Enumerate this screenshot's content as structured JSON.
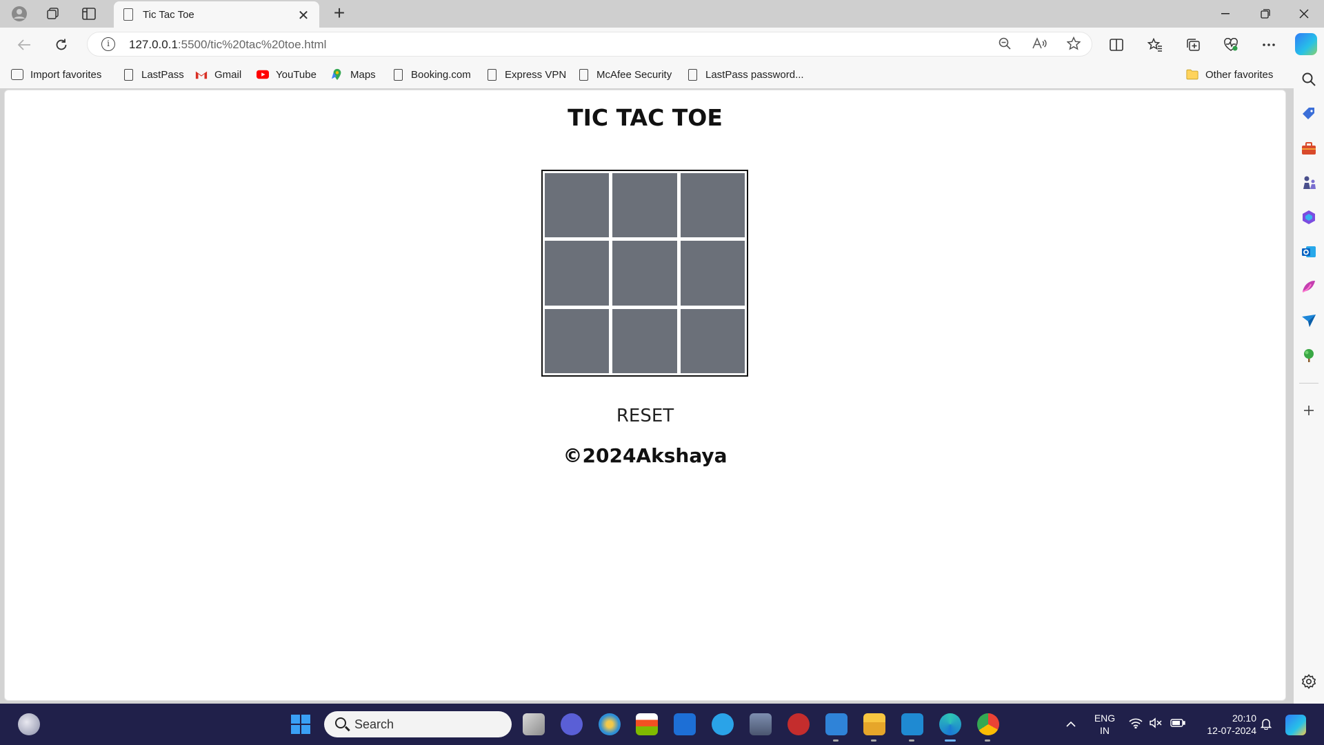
{
  "browser": {
    "tab_title": "Tic Tac Toe",
    "tab_close": "✕",
    "new_tab": "+",
    "url_host": "127.0.0.1",
    "url_rest": ":5500/tic%20tac%20toe.html",
    "favorites": [
      {
        "label": "Import favorites"
      },
      {
        "label": "LastPass"
      },
      {
        "label": "Gmail"
      },
      {
        "label": "YouTube"
      },
      {
        "label": "Maps"
      },
      {
        "label": "Booking.com"
      },
      {
        "label": "Express VPN"
      },
      {
        "label": "McAfee Security"
      },
      {
        "label": "LastPass password..."
      }
    ],
    "other_favorites": "Other favorites"
  },
  "page": {
    "title": "TIC TAC TOE",
    "board": [
      "",
      "",
      "",
      "",
      "",
      "",
      "",
      "",
      ""
    ],
    "reset_label": "RESET",
    "footer": "©2024Akshaya"
  },
  "taskbar": {
    "search_placeholder": "Search",
    "lang_top": "ENG",
    "lang_bottom": "IN",
    "time": "20:10",
    "date": "12-07-2024"
  },
  "colors": {
    "cell": "#6b7079",
    "taskbar": "#20204a"
  }
}
